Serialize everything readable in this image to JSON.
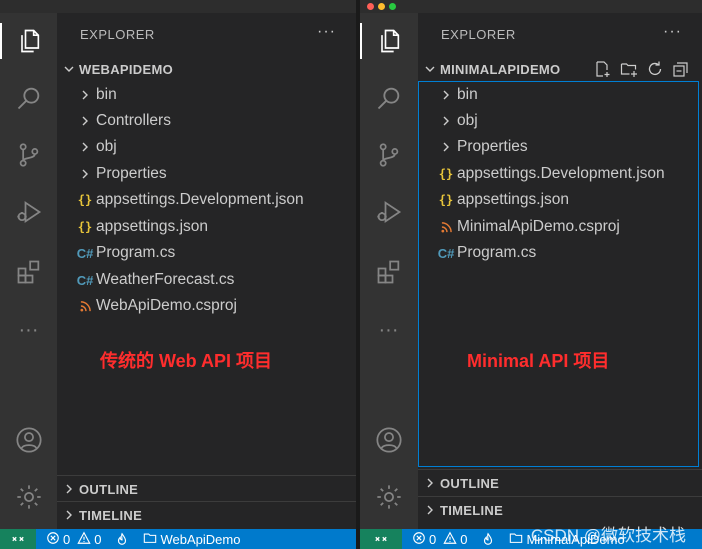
{
  "colors": {
    "activity_bar": "#333333",
    "sidebar": "#252526",
    "statusbar": "#007acc",
    "remote": "#16825d",
    "annotation": "#ff2d2d",
    "json_icon": "#e8c53a",
    "cs_icon": "#519aba",
    "rss_icon": "#e37933"
  },
  "left": {
    "explorer_title": "EXPLORER",
    "more": "···",
    "project": "WEBAPIDEMO",
    "folders": [
      "bin",
      "Controllers",
      "obj",
      "Properties"
    ],
    "files": [
      {
        "name": "appsettings.Development.json",
        "icon": "json-icon"
      },
      {
        "name": "appsettings.json",
        "icon": "json-icon"
      },
      {
        "name": "Program.cs",
        "icon": "csharp-icon"
      },
      {
        "name": "WeatherForecast.cs",
        "icon": "csharp-icon"
      },
      {
        "name": "WebApiDemo.csproj",
        "icon": "rss-icon"
      }
    ],
    "annotation": "传统的 Web API 项目",
    "outline": "OUTLINE",
    "timeline": "TIMELINE",
    "status": {
      "errors": "0",
      "warnings": "0",
      "folder": "WebApiDemo"
    }
  },
  "right": {
    "explorer_title": "EXPLORER",
    "more": "···",
    "project": "MINIMALAPIDEMO",
    "folders": [
      "bin",
      "obj",
      "Properties"
    ],
    "files": [
      {
        "name": "appsettings.Development.json",
        "icon": "json-icon"
      },
      {
        "name": "appsettings.json",
        "icon": "json-icon"
      },
      {
        "name": "MinimalApiDemo.csproj",
        "icon": "rss-icon"
      },
      {
        "name": "Program.cs",
        "icon": "csharp-icon"
      }
    ],
    "annotation": "Minimal  API 项目",
    "outline": "OUTLINE",
    "timeline": "TIMELINE",
    "status": {
      "errors": "0",
      "warnings": "0",
      "folder": "MinimalApiDemo"
    },
    "watermark": "CSDN @微软技术栈"
  }
}
